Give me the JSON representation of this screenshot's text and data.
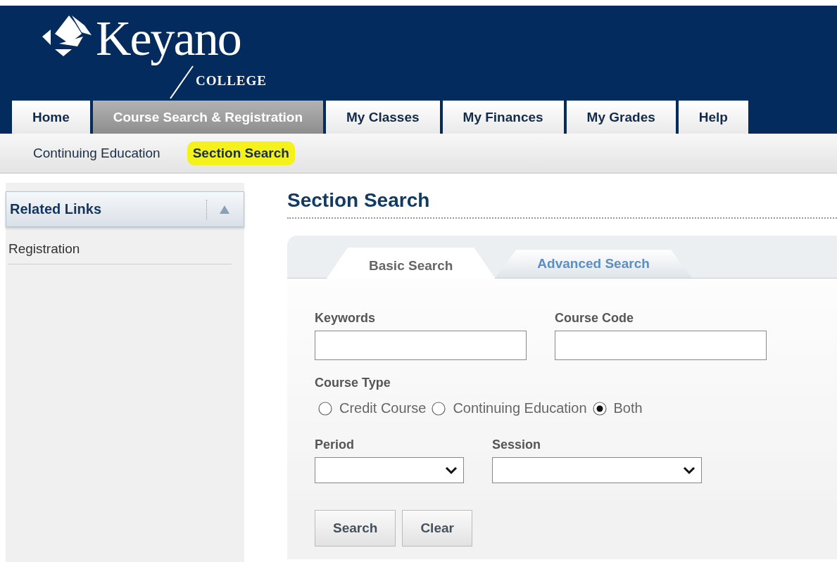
{
  "logo": {
    "name": "Keyano",
    "subtitle": "COLLEGE"
  },
  "tabs": [
    {
      "label": "Home",
      "selected": false
    },
    {
      "label": "Course Search & Registration",
      "selected": true
    },
    {
      "label": "My Classes",
      "selected": false
    },
    {
      "label": "My Finances",
      "selected": false
    },
    {
      "label": "My Grades",
      "selected": false
    },
    {
      "label": "Help",
      "selected": false
    }
  ],
  "subnav": [
    {
      "label": "Continuing Education",
      "highlighted": false
    },
    {
      "label": "Section Search",
      "highlighted": true
    }
  ],
  "sidebar": {
    "title": "Related Links",
    "expanded": true,
    "items": [
      {
        "label": "Registration"
      }
    ]
  },
  "page_title": "Section Search",
  "search_tabs": [
    {
      "label": "Basic Search",
      "selected": true
    },
    {
      "label": "Advanced Search",
      "selected": false
    }
  ],
  "keywords": {
    "label": "Keywords"
  },
  "course_code": {
    "label": "Course Code"
  },
  "course_type": {
    "label": "Course Type",
    "options": [
      {
        "label": "Credit Course",
        "selected": false
      },
      {
        "label": "Continuing Education",
        "selected": false
      },
      {
        "label": "Both",
        "selected": true
      }
    ]
  },
  "period": {
    "label": "Period"
  },
  "session": {
    "label": "Session"
  },
  "buttons": [
    {
      "label": "Search"
    },
    {
      "label": "Clear"
    }
  ]
}
